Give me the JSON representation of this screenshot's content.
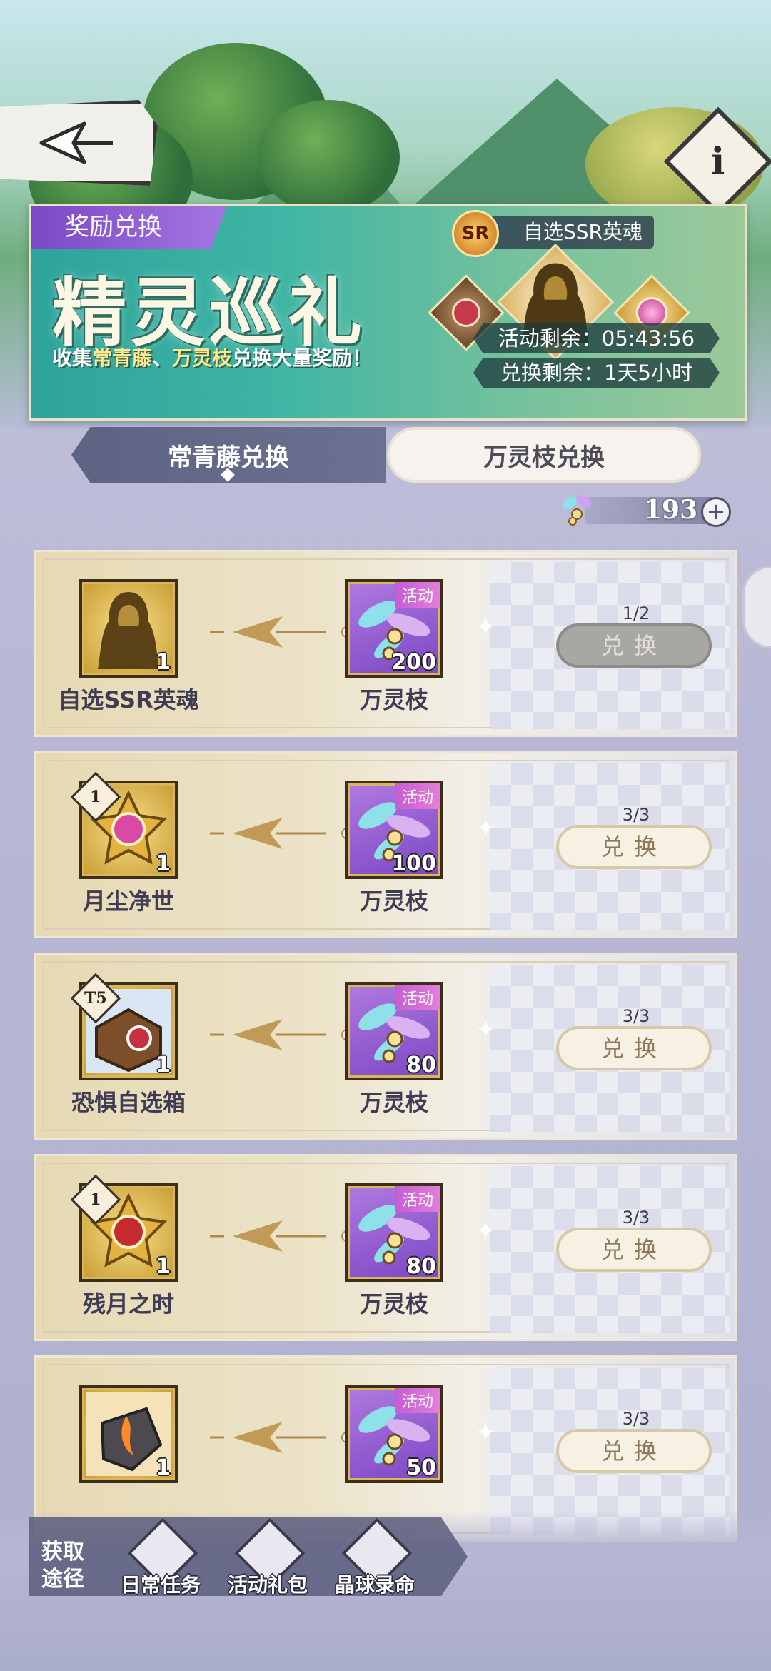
{
  "banner": {
    "tag": "奖励兑换",
    "title": "精灵巡礼",
    "subtitle_prefix": "收集",
    "subtitle_hl1": "常青藤",
    "subtitle_sep": "、",
    "subtitle_hl2": "万灵枝",
    "subtitle_suffix": "兑换大量奖励！",
    "ssr_badge": "SR",
    "ssr_chip": "自选SSR英魂",
    "activity_remaining_label": "活动剩余：",
    "activity_remaining": "05:43:56",
    "exchange_remaining_label": "兑换剩余：",
    "exchange_remaining": "1天5小时"
  },
  "info_button_label": "i",
  "tabs": [
    {
      "label": "常青藤兑换",
      "active": true
    },
    {
      "label": "万灵枝兑换",
      "active": false
    }
  ],
  "currency": {
    "value": "193",
    "plus": "+"
  },
  "rows": [
    {
      "reward_label": "自选SSR英魂",
      "reward_count": "1",
      "tier": "",
      "cost_label": "万灵枝",
      "cost_count": "200",
      "cost_badge": "活动",
      "limit": "1/2",
      "button": "兑换",
      "enabled": false
    },
    {
      "reward_label": "月尘净世",
      "reward_count": "1",
      "tier": "1",
      "cost_label": "万灵枝",
      "cost_count": "100",
      "cost_badge": "活动",
      "limit": "3/3",
      "button": "兑换",
      "enabled": true
    },
    {
      "reward_label": "恐惧自选箱",
      "reward_count": "1",
      "tier": "T5",
      "cost_label": "万灵枝",
      "cost_count": "80",
      "cost_badge": "活动",
      "limit": "3/3",
      "button": "兑换",
      "enabled": true
    },
    {
      "reward_label": "残月之时",
      "reward_count": "1",
      "tier": "1",
      "cost_label": "万灵枝",
      "cost_count": "80",
      "cost_badge": "活动",
      "limit": "3/3",
      "button": "兑换",
      "enabled": true
    },
    {
      "reward_label": "",
      "reward_count": "1",
      "tier": "",
      "cost_label": "",
      "cost_count": "50",
      "cost_badge": "活动",
      "limit": "3/3",
      "button": "兑换",
      "enabled": true
    }
  ],
  "sources": {
    "label": "获取途径",
    "items": [
      {
        "label": "日常任务",
        "icon": "mission-icon"
      },
      {
        "label": "活动礼包",
        "icon": "gift-pack-icon"
      },
      {
        "label": "晶球录命",
        "icon": "crystal-orb-icon"
      }
    ]
  },
  "colors": {
    "accent": "#7b49c7",
    "banner": "#3fb5a4",
    "tab_active": "#5d6382"
  }
}
